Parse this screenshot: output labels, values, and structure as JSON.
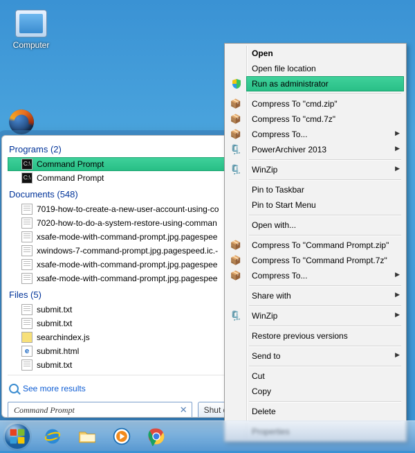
{
  "desktop": {
    "computer_label": "Computer"
  },
  "start": {
    "programs_head": "Programs (2)",
    "program1": "Command Prompt",
    "program2": "Command Prompt",
    "documents_head": "Documents (548)",
    "doc1": "7019-how-to-create-a-new-user-account-using-co",
    "doc2": "7020-how-to-do-a-system-restore-using-comman",
    "doc3": "xsafe-mode-with-command-prompt.jpg.pagespee",
    "doc4": "xwindows-7-command-prompt.jpg.pagespeed.ic.-",
    "doc5": "xsafe-mode-with-command-prompt.jpg.pagespee",
    "doc6": "xsafe-mode-with-command-prompt.jpg.pagespee",
    "files_head": "Files (5)",
    "file1": "submit.txt",
    "file2": "submit.txt",
    "file3": "searchindex.js",
    "file4": "submit.html",
    "file5": "submit.txt",
    "see_more": "See more results",
    "search_value": "Command Prompt",
    "shutdown_label": "Shut do"
  },
  "ctx": {
    "open": "Open",
    "open_loc": "Open file location",
    "run_admin": "Run as administrator",
    "comp_zip": "Compress To \"cmd.zip\"",
    "comp_7z": "Compress To \"cmd.7z\"",
    "comp_to": "Compress To...",
    "powerarch": "PowerArchiver 2013",
    "winzip": "WinZip",
    "pin_tb": "Pin to Taskbar",
    "pin_sm": "Pin to Start Menu",
    "open_with": "Open with...",
    "comp_cpzip": "Compress To \"Command Prompt.zip\"",
    "comp_cp7z": "Compress To \"Command Prompt.7z\"",
    "comp_to2": "Compress To...",
    "share": "Share with",
    "winzip2": "WinZip",
    "restore": "Restore previous versions",
    "send_to": "Send to",
    "cut": "Cut",
    "copy": "Copy",
    "delete": "Delete",
    "props": "Properties"
  }
}
